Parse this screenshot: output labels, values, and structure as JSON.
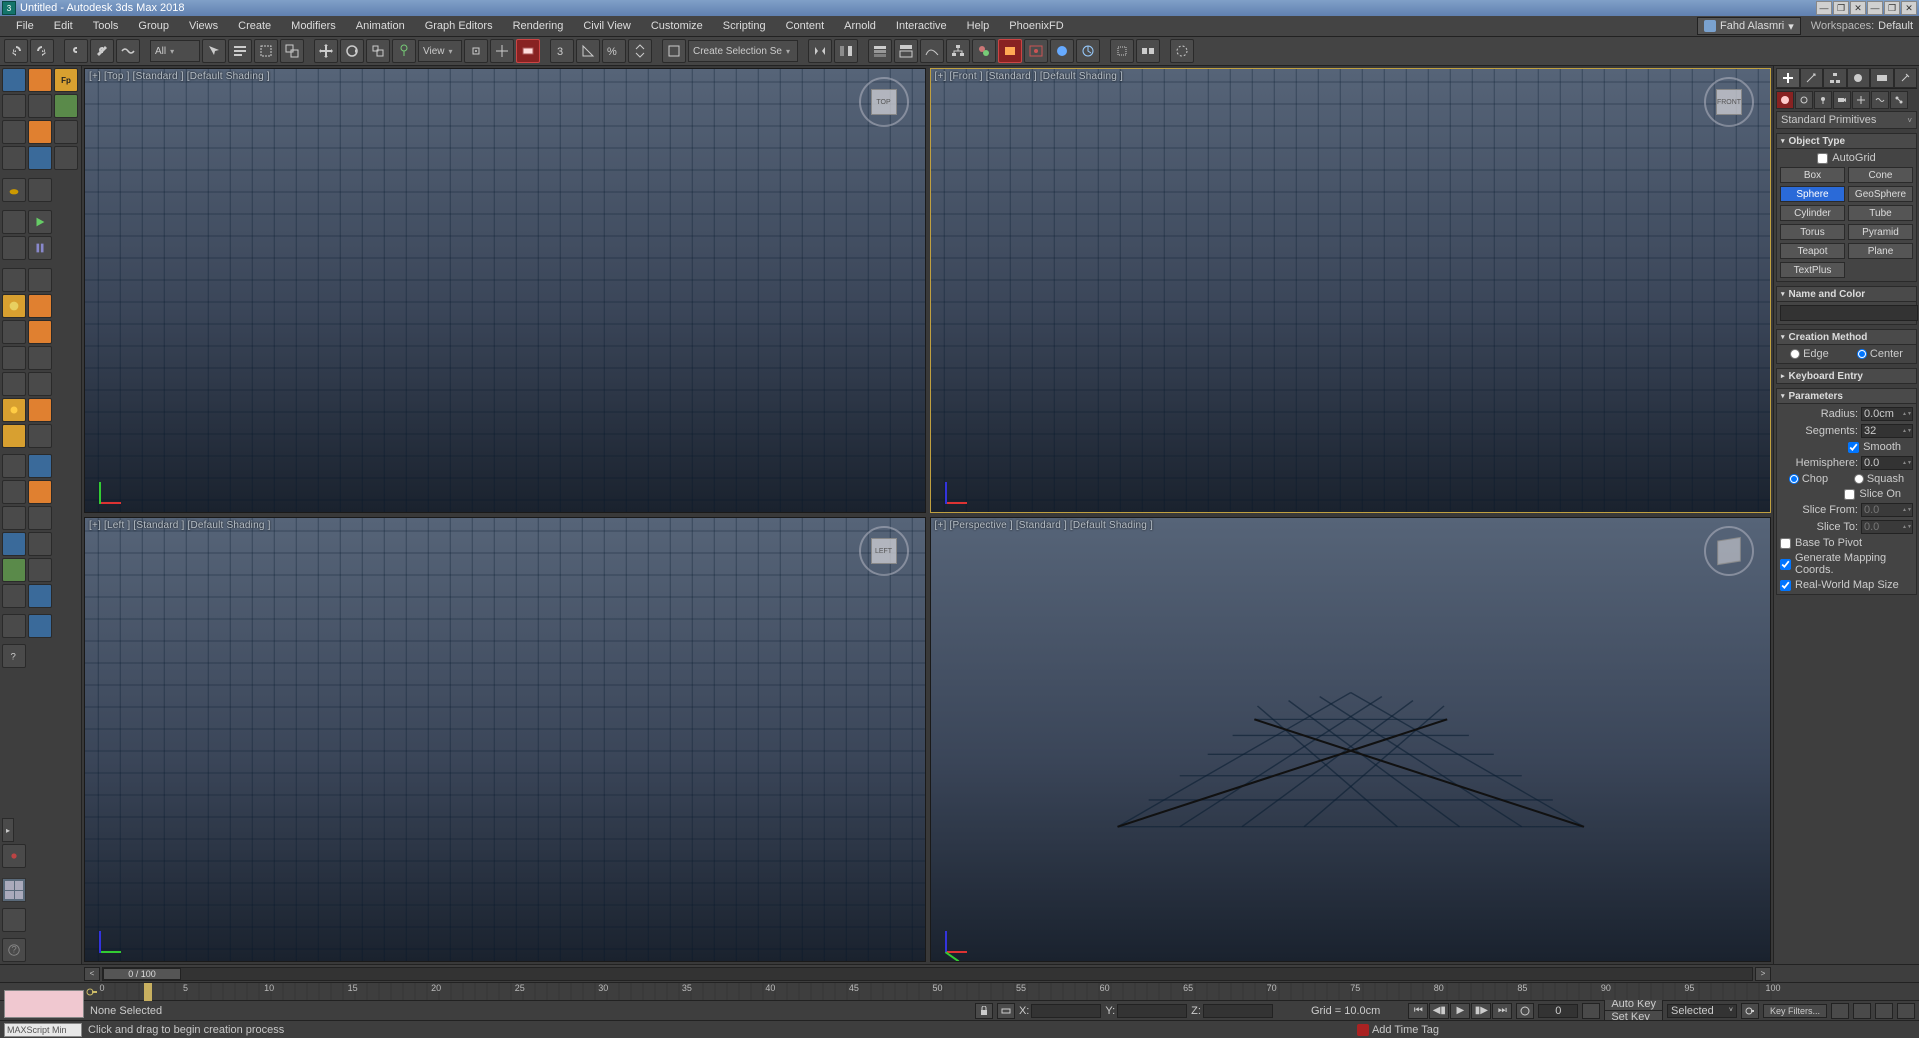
{
  "title": "Untitled - Autodesk 3ds Max 2018",
  "menu": [
    "File",
    "Edit",
    "Tools",
    "Group",
    "Views",
    "Create",
    "Modifiers",
    "Animation",
    "Graph Editors",
    "Rendering",
    "Civil View",
    "Customize",
    "Scripting",
    "Content",
    "Arnold",
    "Interactive",
    "Help",
    "PhoenixFD"
  ],
  "user": "Fahd Alasmri",
  "workspace_label": "Workspaces:",
  "workspace_value": "Default",
  "toolbar": {
    "filter_all": "All",
    "view": "View",
    "create_sel_set": "Create Selection Se"
  },
  "viewports": {
    "top": "[+] [Top ] [Standard ] [Default Shading ]",
    "front": "[+] [Front ] [Standard ] [Default Shading ]",
    "left": "[+] [Left ] [Standard ] [Default Shading ]",
    "persp": "[+] [Perspective ] [Standard ] [Default Shading ]",
    "cube_top": "TOP",
    "cube_front": "FRONT",
    "cube_left": "LEFT"
  },
  "panel": {
    "category": "Standard Primitives",
    "rollouts": {
      "object_type": "Object Type",
      "name_color": "Name and Color",
      "creation_method": "Creation Method",
      "keyboard_entry": "Keyboard Entry",
      "parameters": "Parameters"
    },
    "autogrid": "AutoGrid",
    "objects": [
      [
        "Box",
        "Cone"
      ],
      [
        "Sphere",
        "GeoSphere"
      ],
      [
        "Cylinder",
        "Tube"
      ],
      [
        "Torus",
        "Pyramid"
      ],
      [
        "Teapot",
        "Plane"
      ],
      [
        "TextPlus",
        ""
      ]
    ],
    "selected_object": "Sphere",
    "creation": {
      "edge": "Edge",
      "center": "Center"
    },
    "params": {
      "radius_label": "Radius:",
      "radius_val": "0.0cm",
      "segments_label": "Segments:",
      "segments_val": "32",
      "smooth": "Smooth",
      "hemi_label": "Hemisphere:",
      "hemi_val": "0.0",
      "chop": "Chop",
      "squash": "Squash",
      "slice_on": "Slice On",
      "slice_from_label": "Slice From:",
      "slice_from_val": "0.0",
      "slice_to_label": "Slice To:",
      "slice_to_val": "0.0",
      "base_pivot": "Base To Pivot",
      "gen_mapping": "Generate Mapping Coords.",
      "real_world": "Real-World Map Size"
    }
  },
  "timeline": {
    "thumb": "0 / 100",
    "ticks": [
      "0",
      "5",
      "10",
      "15",
      "20",
      "25",
      "30",
      "35",
      "40",
      "45",
      "50",
      "55",
      "60",
      "65",
      "70",
      "75",
      "80",
      "85",
      "90",
      "95",
      "100"
    ]
  },
  "status": {
    "selection": "None Selected",
    "x": "X:",
    "y": "Y:",
    "z": "Z:",
    "grid": "Grid = 10.0cm",
    "frame": "0",
    "autokey": "Auto Key",
    "setkey": "Set Key",
    "selected_filter": "Selected",
    "keyfilters": "Key Filters..."
  },
  "prompt": {
    "maxscript": "MAXScript Min",
    "hint": "Click and drag to begin creation process",
    "add_time_tag": "Add Time Tag"
  }
}
